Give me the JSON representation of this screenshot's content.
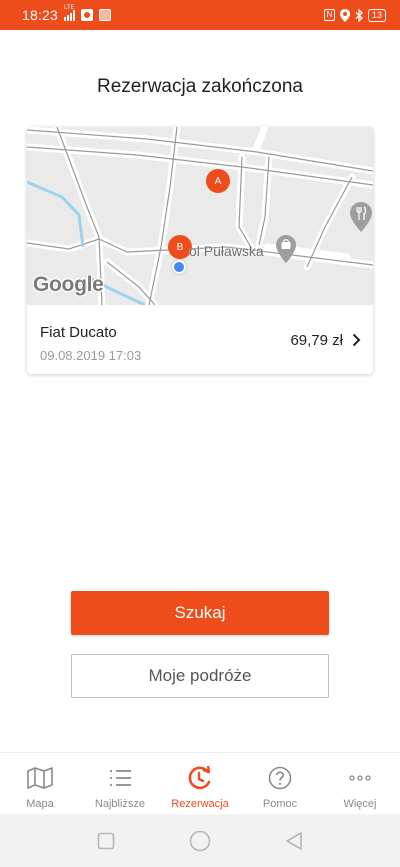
{
  "status_bar": {
    "time": "18:23",
    "network": "LTE",
    "battery": "13",
    "accent": "#ef4c1c"
  },
  "page": {
    "title": "Rezerwacja zakończona"
  },
  "map": {
    "marker_a": "A",
    "marker_b": "B",
    "poi_label": "ol Puławska",
    "attribution": "Google",
    "icons": [
      "fork-knife-icon",
      "shopping-bag-icon",
      "location-dot-icon"
    ]
  },
  "trip": {
    "vehicle": "Fiat Ducato",
    "date": "09.08.2019 17:03",
    "price": "69,79 zł"
  },
  "actions": {
    "search_label": "Szukaj",
    "my_trips_label": "Moje podróże"
  },
  "bottom_nav": {
    "items": [
      {
        "label": "Mapa",
        "icon": "map-icon",
        "active": false
      },
      {
        "label": "Najbliższe",
        "icon": "list-icon",
        "active": false
      },
      {
        "label": "Rezerwacja",
        "icon": "reservation-icon",
        "active": true
      },
      {
        "label": "Pomoc",
        "icon": "help-icon",
        "active": false
      },
      {
        "label": "Więcej",
        "icon": "more-icon",
        "active": false
      }
    ]
  },
  "system_nav": {
    "icons": [
      "recents-icon",
      "home-icon",
      "back-icon"
    ]
  }
}
